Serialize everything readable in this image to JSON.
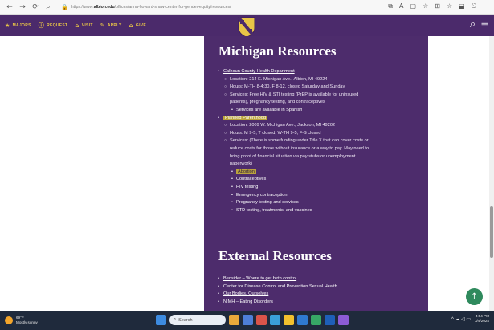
{
  "browser": {
    "url_prefix": "https://www.",
    "url_host": "albion.edu",
    "url_path": "/offices/anna-howard-shaw-center-for-gender-equity/resources/",
    "nav": {
      "back": "←",
      "forward": "→",
      "refresh": "⟳",
      "search": "⌕"
    },
    "right_icons": [
      "⧉",
      "A",
      "▢",
      "☆",
      "⊞",
      "☆",
      "⬓",
      "⎋",
      "⋯"
    ]
  },
  "site_header": {
    "util_nav": [
      {
        "icon": "★",
        "label": "MAJORS"
      },
      {
        "icon": "ⓘ",
        "label": "REQUEST"
      },
      {
        "icon": "⌂",
        "label": "VISIT"
      },
      {
        "icon": "✎",
        "label": "APPLY"
      },
      {
        "icon": "⌂",
        "label": "GIVE"
      }
    ],
    "search_icon": "⌕",
    "menu_icon": "≡"
  },
  "content": {
    "michigan": {
      "title": "Michigan Resources",
      "calhoun": {
        "name": "Calhoun County Health Department",
        "location": "Location: 214 E. Michigan Ave., Albion, MI 49224",
        "hours": "Hours: M-TH 8-4:30, F 8-12, closed Saturday and Sunday",
        "services_1": "Services: Free HIV & STI testing (PrEP is available for uninsured",
        "services_2": "patients), pregnancy testing, and contraceptives",
        "spanish": "Services are available in Spanish"
      },
      "planned": {
        "name": "Planned Parenthood",
        "location": "Location: 2009 W. Michigan Ave., Jackson, MI 49202",
        "hours": "Hours: M 9-5, T closed, W-TH 9-5, F-S closed",
        "services_1": "Services: (There is some funding under Title X that can cover costs or",
        "services_2": "reduce costs for those without insurance or a way to pay. May need to",
        "services_3": "bring proof of financial situation via pay stubs or unemployment",
        "services_4": "paperwork)",
        "items": [
          "Abortion",
          "Contraceptives",
          "HIV testing",
          "Emergency contraception",
          "Pregnancy testing and services",
          "STD testing, treatments, and vaccines"
        ]
      }
    },
    "external": {
      "title": "External Resources",
      "items": [
        "Bedsider – Where to get birth control",
        "Center for Disease Control and Prevention Sexual Health",
        "Our Bodies, Ourselves",
        "NIMH – Eating Disorders"
      ]
    }
  },
  "back_to_top": "↑",
  "taskbar": {
    "weather_temp": "69°F",
    "weather_desc": "Mostly sunny",
    "search_label": "Search",
    "time": "4:54 PM",
    "date": "3/4/2024",
    "tray_icons": "^ ☁ ◁ ▭"
  },
  "colors": {
    "purple": "#4d2c6c",
    "gold": "#e8c547",
    "highlight": "#bba33d",
    "taskbar": "#1f2a3c"
  }
}
